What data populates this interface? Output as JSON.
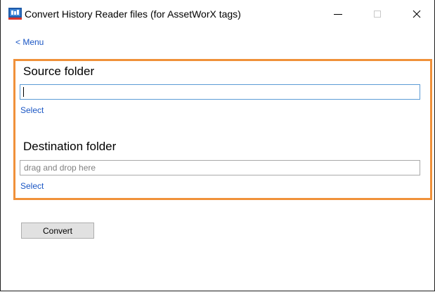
{
  "window": {
    "title": "Convert History Reader files (for AssetWorX tags)",
    "icon": "app-icon",
    "controls": {
      "minimize": "minimize-icon",
      "maximize": "maximize-icon",
      "close": "close-icon"
    }
  },
  "nav": {
    "menu_link": "< Menu"
  },
  "source": {
    "title": "Source folder",
    "value": "",
    "placeholder": "",
    "select_label": "Select"
  },
  "destination": {
    "title": "Destination folder",
    "value": "",
    "placeholder": "drag and drop here",
    "select_label": "Select"
  },
  "actions": {
    "convert_label": "Convert"
  },
  "colors": {
    "link": "#1a56c4",
    "highlight_border": "#f0913a",
    "focused_field_border": "#5b9bd5",
    "button_bg": "#e1e1e1"
  }
}
